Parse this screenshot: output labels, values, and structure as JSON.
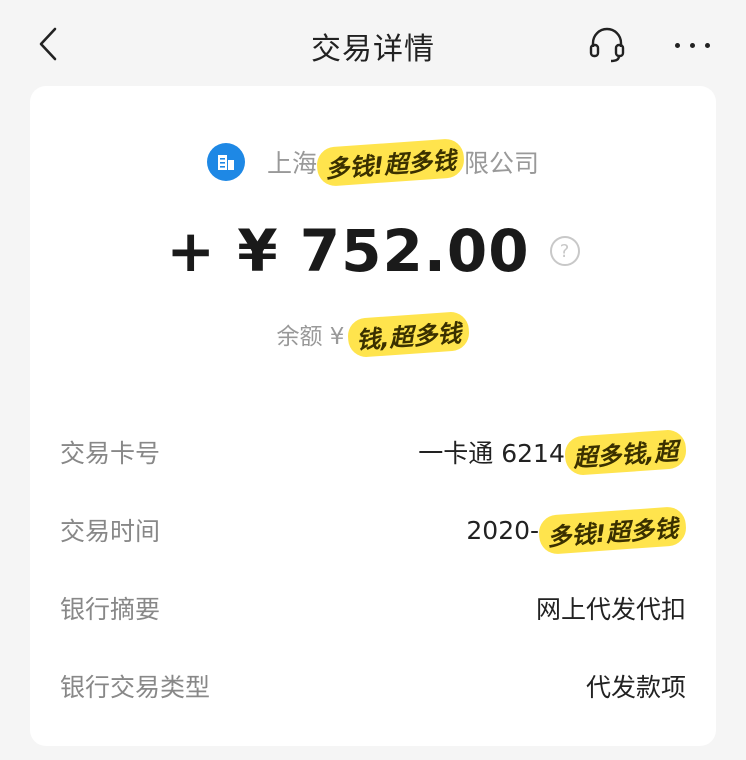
{
  "nav": {
    "title": "交易详情",
    "back_icon": "chevron-left-icon",
    "service_icon": "headset-icon",
    "more_icon": "more-horizontal-icon"
  },
  "merchant": {
    "icon": "building-icon",
    "name_prefix": "上海",
    "name_redacted": "多钱!超多钱",
    "name_suffix": "限公司"
  },
  "amount": {
    "value": "+ ¥ 752.00",
    "help_icon": "question-circle-icon"
  },
  "balance": {
    "label": "余额 ¥",
    "redacted": "钱,超多钱"
  },
  "details": [
    {
      "label": "交易卡号",
      "value": "一卡通 6214",
      "redacted": "超多钱,超"
    },
    {
      "label": "交易时间",
      "value": "2020-",
      "redacted": "多钱!超多钱"
    },
    {
      "label": "银行摘要",
      "value": "网上代发代扣"
    },
    {
      "label": "银行交易类型",
      "value": "代发款项"
    }
  ],
  "colors": {
    "accent": "#1e88e5",
    "highlight": "#ffe44d",
    "background": "#f5f5f5"
  }
}
